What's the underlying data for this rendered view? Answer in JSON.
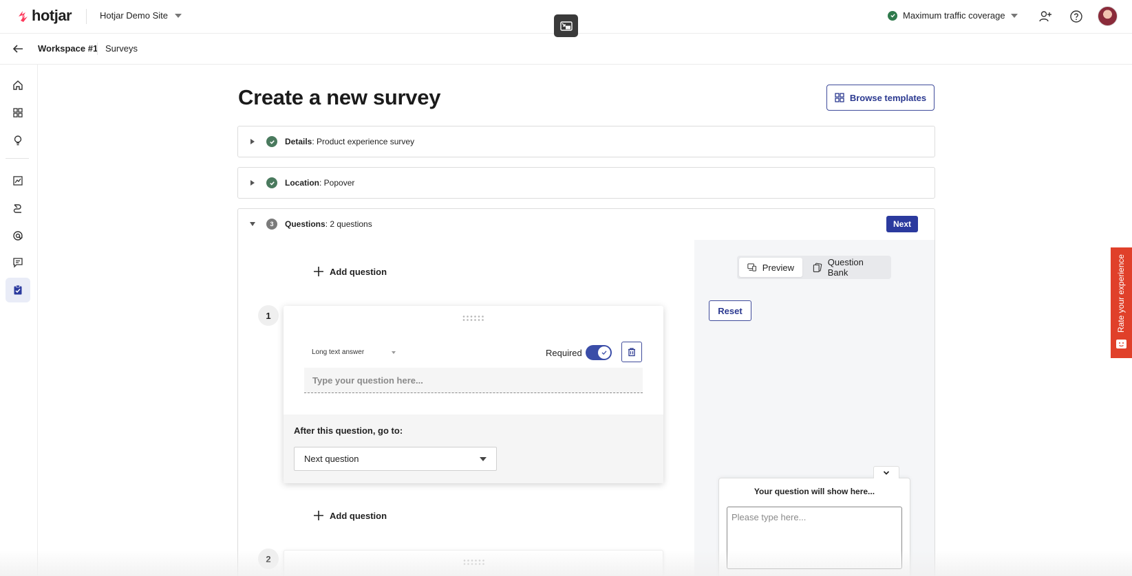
{
  "app": {
    "brand": "hotjar",
    "site_name": "Hotjar Demo Site",
    "traffic_label": "Maximum traffic coverage",
    "colors": {
      "brand": "#fd3a5c",
      "accent": "#2b3a9e",
      "success": "#2f7a4c",
      "rate_tab": "#e0402a"
    }
  },
  "breadcrumb": {
    "items": [
      "Workspace #1",
      "Surveys"
    ]
  },
  "sidebar": {
    "icons": [
      "home-icon",
      "dashboard-icon",
      "lightbulb-icon",
      "trends-icon",
      "recordings-icon",
      "engage-icon",
      "feedback-icon",
      "surveys-icon"
    ],
    "active": "surveys-icon"
  },
  "page": {
    "title": "Create a new survey",
    "browse_label": "Browse templates"
  },
  "sections": {
    "details": {
      "label": "Details",
      "value": ": Product experience survey"
    },
    "location": {
      "label": "Location",
      "value": ": Popover"
    },
    "questions": {
      "number": "3",
      "label": "Questions",
      "value": ": 2 questions",
      "next_label": "Next"
    }
  },
  "editor": {
    "add_question_label": "Add question",
    "questions": [
      {
        "number": "1",
        "type": "Long text answer",
        "required_label": "Required",
        "required": true,
        "placeholder": "Type your question here...",
        "after_label": "After this question, go to:",
        "goto_value": "Next question"
      },
      {
        "number": "2"
      }
    ]
  },
  "preview": {
    "tabs": [
      "Preview",
      "Question Bank"
    ],
    "active_tab": "Preview",
    "reset_label": "Reset",
    "widget_question": "Your question will show here...",
    "widget_placeholder": "Please type here..."
  },
  "rate_tab": {
    "label": "Rate your experience"
  }
}
